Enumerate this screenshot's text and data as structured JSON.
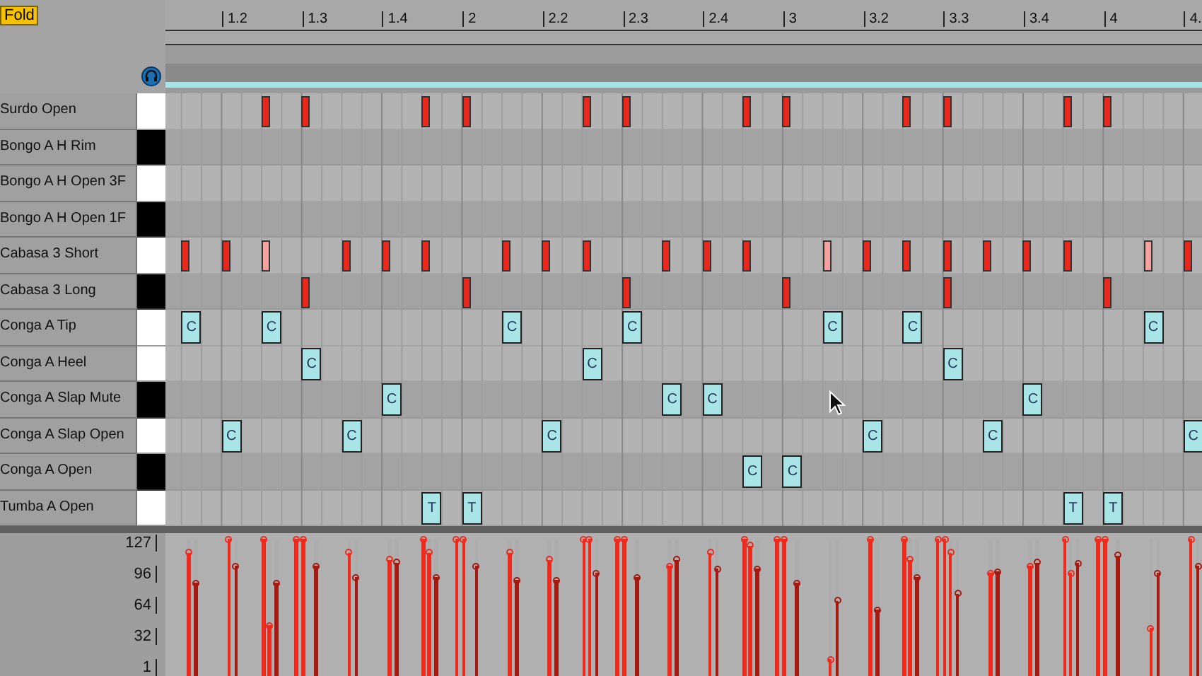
{
  "fold_button": {
    "label": "Fold"
  },
  "ruler": [
    "1.2",
    "1.3",
    "1.4",
    "2",
    "2.2",
    "2.3",
    "2.4",
    "3",
    "3.2",
    "3.3",
    "3.4",
    "4",
    "4."
  ],
  "rows": [
    {
      "name": "Surdo Open",
      "black_key": false,
      "notes": [
        {
          "selected": false,
          "level": 1
        },
        {
          "selected": false,
          "level": 1
        },
        {
          "selected": false,
          "level": 1
        },
        {
          "selected": false,
          "level": 1
        },
        {
          "selected": false,
          "level": 1
        },
        {
          "selected": false,
          "level": 1
        },
        {
          "selected": false,
          "level": 1
        },
        {
          "selected": false,
          "level": 1
        },
        {
          "selected": false,
          "level": 1
        },
        {
          "selected": false,
          "level": 1
        },
        {
          "selected": false,
          "level": 1
        },
        {
          "selected": false,
          "level": 1
        }
      ]
    },
    {
      "name": "Bongo A H Rim",
      "black_key": true
    },
    {
      "name": "Bongo A H Open 3F",
      "black_key": false
    },
    {
      "name": "Bongo A H Open 1F",
      "black_key": true
    },
    {
      "name": "Cabasa 3 Short",
      "black_key": false,
      "notes": [
        {
          "selected": false,
          "level": 0.9
        },
        {
          "selected": false,
          "level": 1
        },
        {
          "selected": false,
          "level": 0.37
        },
        {
          "selected": false,
          "level": 0.9
        },
        {
          "selected": false,
          "level": 0.85
        },
        {
          "selected": false,
          "level": 0.9
        },
        {
          "selected": false,
          "level": 0.9
        },
        {
          "selected": false,
          "level": 0.85
        },
        {
          "selected": false,
          "level": 1
        },
        {
          "selected": false,
          "level": 0.8
        },
        {
          "selected": false,
          "level": 0.9
        },
        {
          "selected": false,
          "level": 0.95
        },
        {
          "selected": false,
          "level": 0.12
        },
        {
          "selected": false,
          "level": 1
        },
        {
          "selected": false,
          "level": 0.85
        },
        {
          "selected": false,
          "level": 0.9
        },
        {
          "selected": false,
          "level": 0.75
        },
        {
          "selected": false,
          "level": 0.8
        },
        {
          "selected": false,
          "level": 0.75
        },
        {
          "selected": false,
          "level": 0.35
        },
        {
          "selected": false,
          "level": 1
        }
      ]
    },
    {
      "name": "Cabasa 3 Long",
      "black_key": true,
      "notes": [
        {
          "selected": false,
          "level": 1
        },
        {
          "selected": false,
          "level": 1
        },
        {
          "selected": false,
          "level": 1
        },
        {
          "selected": false,
          "level": 1
        },
        {
          "selected": false,
          "level": 1
        },
        {
          "selected": false,
          "level": 1
        }
      ]
    },
    {
      "name": "Conga A Tip",
      "black_key": false,
      "notes": [
        {
          "selected": true,
          "label": "C",
          "level": 0.68
        },
        {
          "selected": true,
          "label": "C",
          "level": 0.68
        },
        {
          "selected": true,
          "label": "C",
          "level": 0.7
        },
        {
          "selected": true,
          "label": "C",
          "level": 0.72
        },
        {
          "selected": true,
          "label": "C",
          "level": 0.55
        },
        {
          "selected": true,
          "label": "C",
          "level": 0.72
        },
        {
          "selected": true,
          "label": "C",
          "level": 0.75
        }
      ]
    },
    {
      "name": "Conga A Heel",
      "black_key": false,
      "notes": [
        {
          "selected": true,
          "label": "C",
          "level": 0.8
        },
        {
          "selected": true,
          "label": "C",
          "level": 0.75
        },
        {
          "selected": true,
          "label": "C",
          "level": 0.6
        }
      ]
    },
    {
      "name": "Conga A Slap Mute",
      "black_key": true,
      "notes": [
        {
          "selected": true,
          "label": "C",
          "level": 0.83
        },
        {
          "selected": true,
          "label": "C",
          "level": 0.85
        },
        {
          "selected": true,
          "label": "C",
          "level": 0.78
        },
        {
          "selected": true,
          "label": "C",
          "level": 0.83
        }
      ]
    },
    {
      "name": "Conga A Slap Open",
      "black_key": false,
      "notes": [
        {
          "selected": true,
          "label": "C",
          "level": 0.8
        },
        {
          "selected": true,
          "label": "C",
          "level": 0.72
        },
        {
          "selected": true,
          "label": "C",
          "level": 0.7
        },
        {
          "selected": true,
          "label": "C",
          "level": 0.48
        },
        {
          "selected": true,
          "label": "C",
          "level": 0.76
        },
        {
          "selected": true,
          "label": "C",
          "level": 0.8
        }
      ]
    },
    {
      "name": "Conga A Open",
      "black_key": true,
      "notes": [
        {
          "selected": true,
          "label": "C",
          "level": 0.78
        },
        {
          "selected": true,
          "label": "C",
          "level": 0.68
        }
      ]
    },
    {
      "name": "Tumba A Open",
      "black_key": false,
      "notes": [
        {
          "selected": true,
          "label": "T",
          "level": 0.72
        },
        {
          "selected": true,
          "label": "T",
          "level": 0.8
        },
        {
          "selected": true,
          "label": "T",
          "level": 0.82
        },
        {
          "selected": true,
          "label": "T",
          "level": 0.88
        }
      ]
    }
  ],
  "velocity_axis": [
    "127",
    "96",
    "64",
    "32",
    "1"
  ]
}
